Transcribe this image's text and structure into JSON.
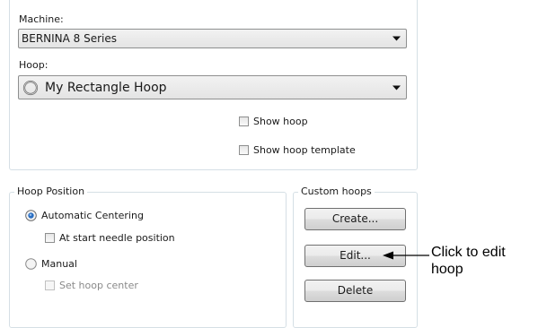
{
  "machine": {
    "label": "Machine:",
    "selected": "BERNINA 8 Series"
  },
  "hoop": {
    "label": "Hoop:",
    "selected": "My Rectangle Hoop",
    "icon": "hoop-ring-icon"
  },
  "checkboxes": {
    "show_hoop": {
      "label": "Show hoop",
      "checked": false
    },
    "show_hoop_template": {
      "label": "Show hoop template",
      "checked": false
    }
  },
  "hoop_position": {
    "title": "Hoop Position",
    "automatic_centering": {
      "label": "Automatic Centering",
      "selected": true
    },
    "at_start_needle_position": {
      "label": "At start needle position",
      "checked": false
    },
    "manual": {
      "label": "Manual",
      "selected": false
    },
    "set_hoop_center": {
      "label": "Set hoop center",
      "checked": false,
      "enabled": false
    }
  },
  "custom_hoops": {
    "title": "Custom hoops",
    "create_label": "Create...",
    "edit_label": "Edit...",
    "delete_label": "Delete"
  },
  "annotation": {
    "line1": "Click to edit",
    "line2": "hoop"
  }
}
